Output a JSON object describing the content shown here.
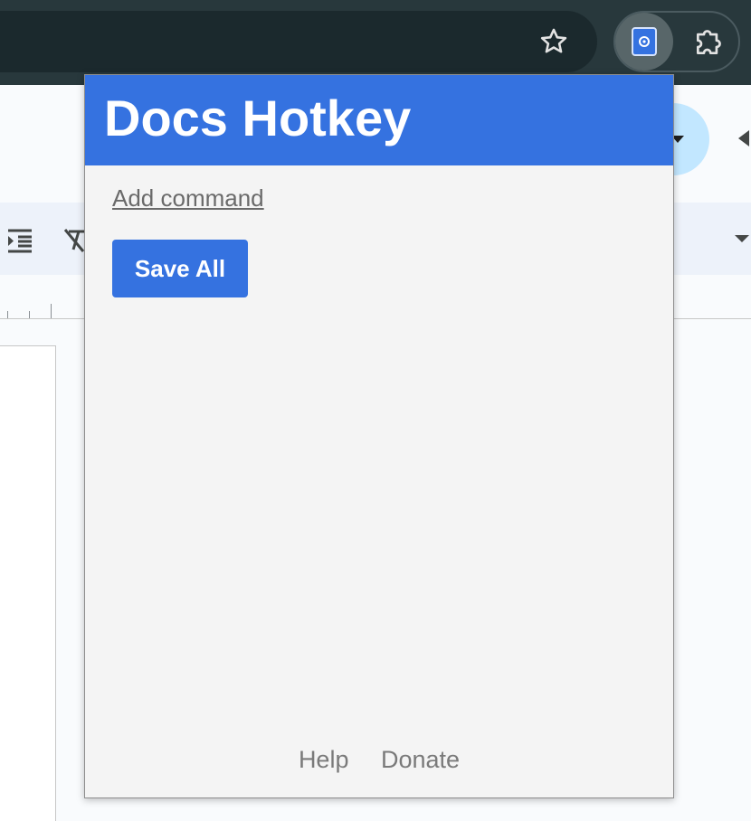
{
  "browser": {
    "toolbar": {
      "bookmark_icon": "star-outline-icon",
      "active_extension_icon": "docs-hotkey-extension-icon",
      "extensions_menu_icon": "puzzle-piece-icon"
    }
  },
  "background": {
    "toolbar_icons": [
      "indent-icon",
      "clear-formatting-icon"
    ]
  },
  "popup": {
    "title": "Docs Hotkey",
    "add_command_label": "Add command",
    "save_all_label": "Save All",
    "footer": {
      "help_label": "Help",
      "donate_label": "Donate"
    }
  },
  "colors": {
    "accent": "#3572e0",
    "popup_background": "#f4f4f4",
    "chrome_background": "#28383c",
    "link_gray": "#6a6a6a"
  }
}
